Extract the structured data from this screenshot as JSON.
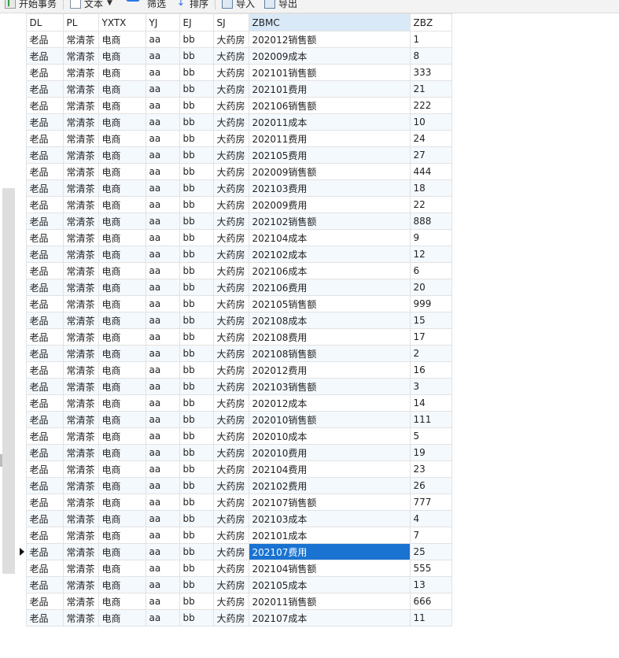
{
  "toolbar": {
    "begin_label": "开始事务",
    "text_label": "文本",
    "filter_label": "筛选",
    "sort_label": "排序",
    "import_label": "导入",
    "export_label": "导出"
  },
  "columns": [
    "DL",
    "PL",
    "YXTX",
    "YJ",
    "EJ",
    "SJ",
    "ZBMC",
    "ZBZ"
  ],
  "sorted_column": "ZBMC",
  "selected_row": 31,
  "selected_column": "ZBMC",
  "accent_color": "#1a73d1",
  "rows": [
    [
      "老品",
      "常清茶",
      "电商",
      "aa",
      "bb",
      "大药房",
      "202012销售额",
      "1"
    ],
    [
      "老品",
      "常清茶",
      "电商",
      "aa",
      "bb",
      "大药房",
      "202009成本",
      "8"
    ],
    [
      "老品",
      "常清茶",
      "电商",
      "aa",
      "bb",
      "大药房",
      "202101销售额",
      "333"
    ],
    [
      "老品",
      "常清茶",
      "电商",
      "aa",
      "bb",
      "大药房",
      "202101费用",
      "21"
    ],
    [
      "老品",
      "常清茶",
      "电商",
      "aa",
      "bb",
      "大药房",
      "202106销售额",
      "222"
    ],
    [
      "老品",
      "常清茶",
      "电商",
      "aa",
      "bb",
      "大药房",
      "202011成本",
      "10"
    ],
    [
      "老品",
      "常清茶",
      "电商",
      "aa",
      "bb",
      "大药房",
      "202011费用",
      "24"
    ],
    [
      "老品",
      "常清茶",
      "电商",
      "aa",
      "bb",
      "大药房",
      "202105费用",
      "27"
    ],
    [
      "老品",
      "常清茶",
      "电商",
      "aa",
      "bb",
      "大药房",
      "202009销售额",
      "444"
    ],
    [
      "老品",
      "常清茶",
      "电商",
      "aa",
      "bb",
      "大药房",
      "202103费用",
      "18"
    ],
    [
      "老品",
      "常清茶",
      "电商",
      "aa",
      "bb",
      "大药房",
      "202009费用",
      "22"
    ],
    [
      "老品",
      "常清茶",
      "电商",
      "aa",
      "bb",
      "大药房",
      "202102销售额",
      "888"
    ],
    [
      "老品",
      "常清茶",
      "电商",
      "aa",
      "bb",
      "大药房",
      "202104成本",
      "9"
    ],
    [
      "老品",
      "常清茶",
      "电商",
      "aa",
      "bb",
      "大药房",
      "202102成本",
      "12"
    ],
    [
      "老品",
      "常清茶",
      "电商",
      "aa",
      "bb",
      "大药房",
      "202106成本",
      "6"
    ],
    [
      "老品",
      "常清茶",
      "电商",
      "aa",
      "bb",
      "大药房",
      "202106费用",
      "20"
    ],
    [
      "老品",
      "常清茶",
      "电商",
      "aa",
      "bb",
      "大药房",
      "202105销售额",
      "999"
    ],
    [
      "老品",
      "常清茶",
      "电商",
      "aa",
      "bb",
      "大药房",
      "202108成本",
      "15"
    ],
    [
      "老品",
      "常清茶",
      "电商",
      "aa",
      "bb",
      "大药房",
      "202108费用",
      "17"
    ],
    [
      "老品",
      "常清茶",
      "电商",
      "aa",
      "bb",
      "大药房",
      "202108销售额",
      "2"
    ],
    [
      "老品",
      "常清茶",
      "电商",
      "aa",
      "bb",
      "大药房",
      "202012费用",
      "16"
    ],
    [
      "老品",
      "常清茶",
      "电商",
      "aa",
      "bb",
      "大药房",
      "202103销售额",
      "3"
    ],
    [
      "老品",
      "常清茶",
      "电商",
      "aa",
      "bb",
      "大药房",
      "202012成本",
      "14"
    ],
    [
      "老品",
      "常清茶",
      "电商",
      "aa",
      "bb",
      "大药房",
      "202010销售额",
      "111"
    ],
    [
      "老品",
      "常清茶",
      "电商",
      "aa",
      "bb",
      "大药房",
      "202010成本",
      "5"
    ],
    [
      "老品",
      "常清茶",
      "电商",
      "aa",
      "bb",
      "大药房",
      "202010费用",
      "19"
    ],
    [
      "老品",
      "常清茶",
      "电商",
      "aa",
      "bb",
      "大药房",
      "202104费用",
      "23"
    ],
    [
      "老品",
      "常清茶",
      "电商",
      "aa",
      "bb",
      "大药房",
      "202102费用",
      "26"
    ],
    [
      "老品",
      "常清茶",
      "电商",
      "aa",
      "bb",
      "大药房",
      "202107销售额",
      "777"
    ],
    [
      "老品",
      "常清茶",
      "电商",
      "aa",
      "bb",
      "大药房",
      "202103成本",
      "4"
    ],
    [
      "老品",
      "常清茶",
      "电商",
      "aa",
      "bb",
      "大药房",
      "202101成本",
      "7"
    ],
    [
      "老品",
      "常清茶",
      "电商",
      "aa",
      "bb",
      "大药房",
      "202107费用",
      "25"
    ],
    [
      "老品",
      "常清茶",
      "电商",
      "aa",
      "bb",
      "大药房",
      "202104销售额",
      "555"
    ],
    [
      "老品",
      "常清茶",
      "电商",
      "aa",
      "bb",
      "大药房",
      "202105成本",
      "13"
    ],
    [
      "老品",
      "常清茶",
      "电商",
      "aa",
      "bb",
      "大药房",
      "202011销售额",
      "666"
    ],
    [
      "老品",
      "常清茶",
      "电商",
      "aa",
      "bb",
      "大药房",
      "202107成本",
      "11"
    ]
  ]
}
